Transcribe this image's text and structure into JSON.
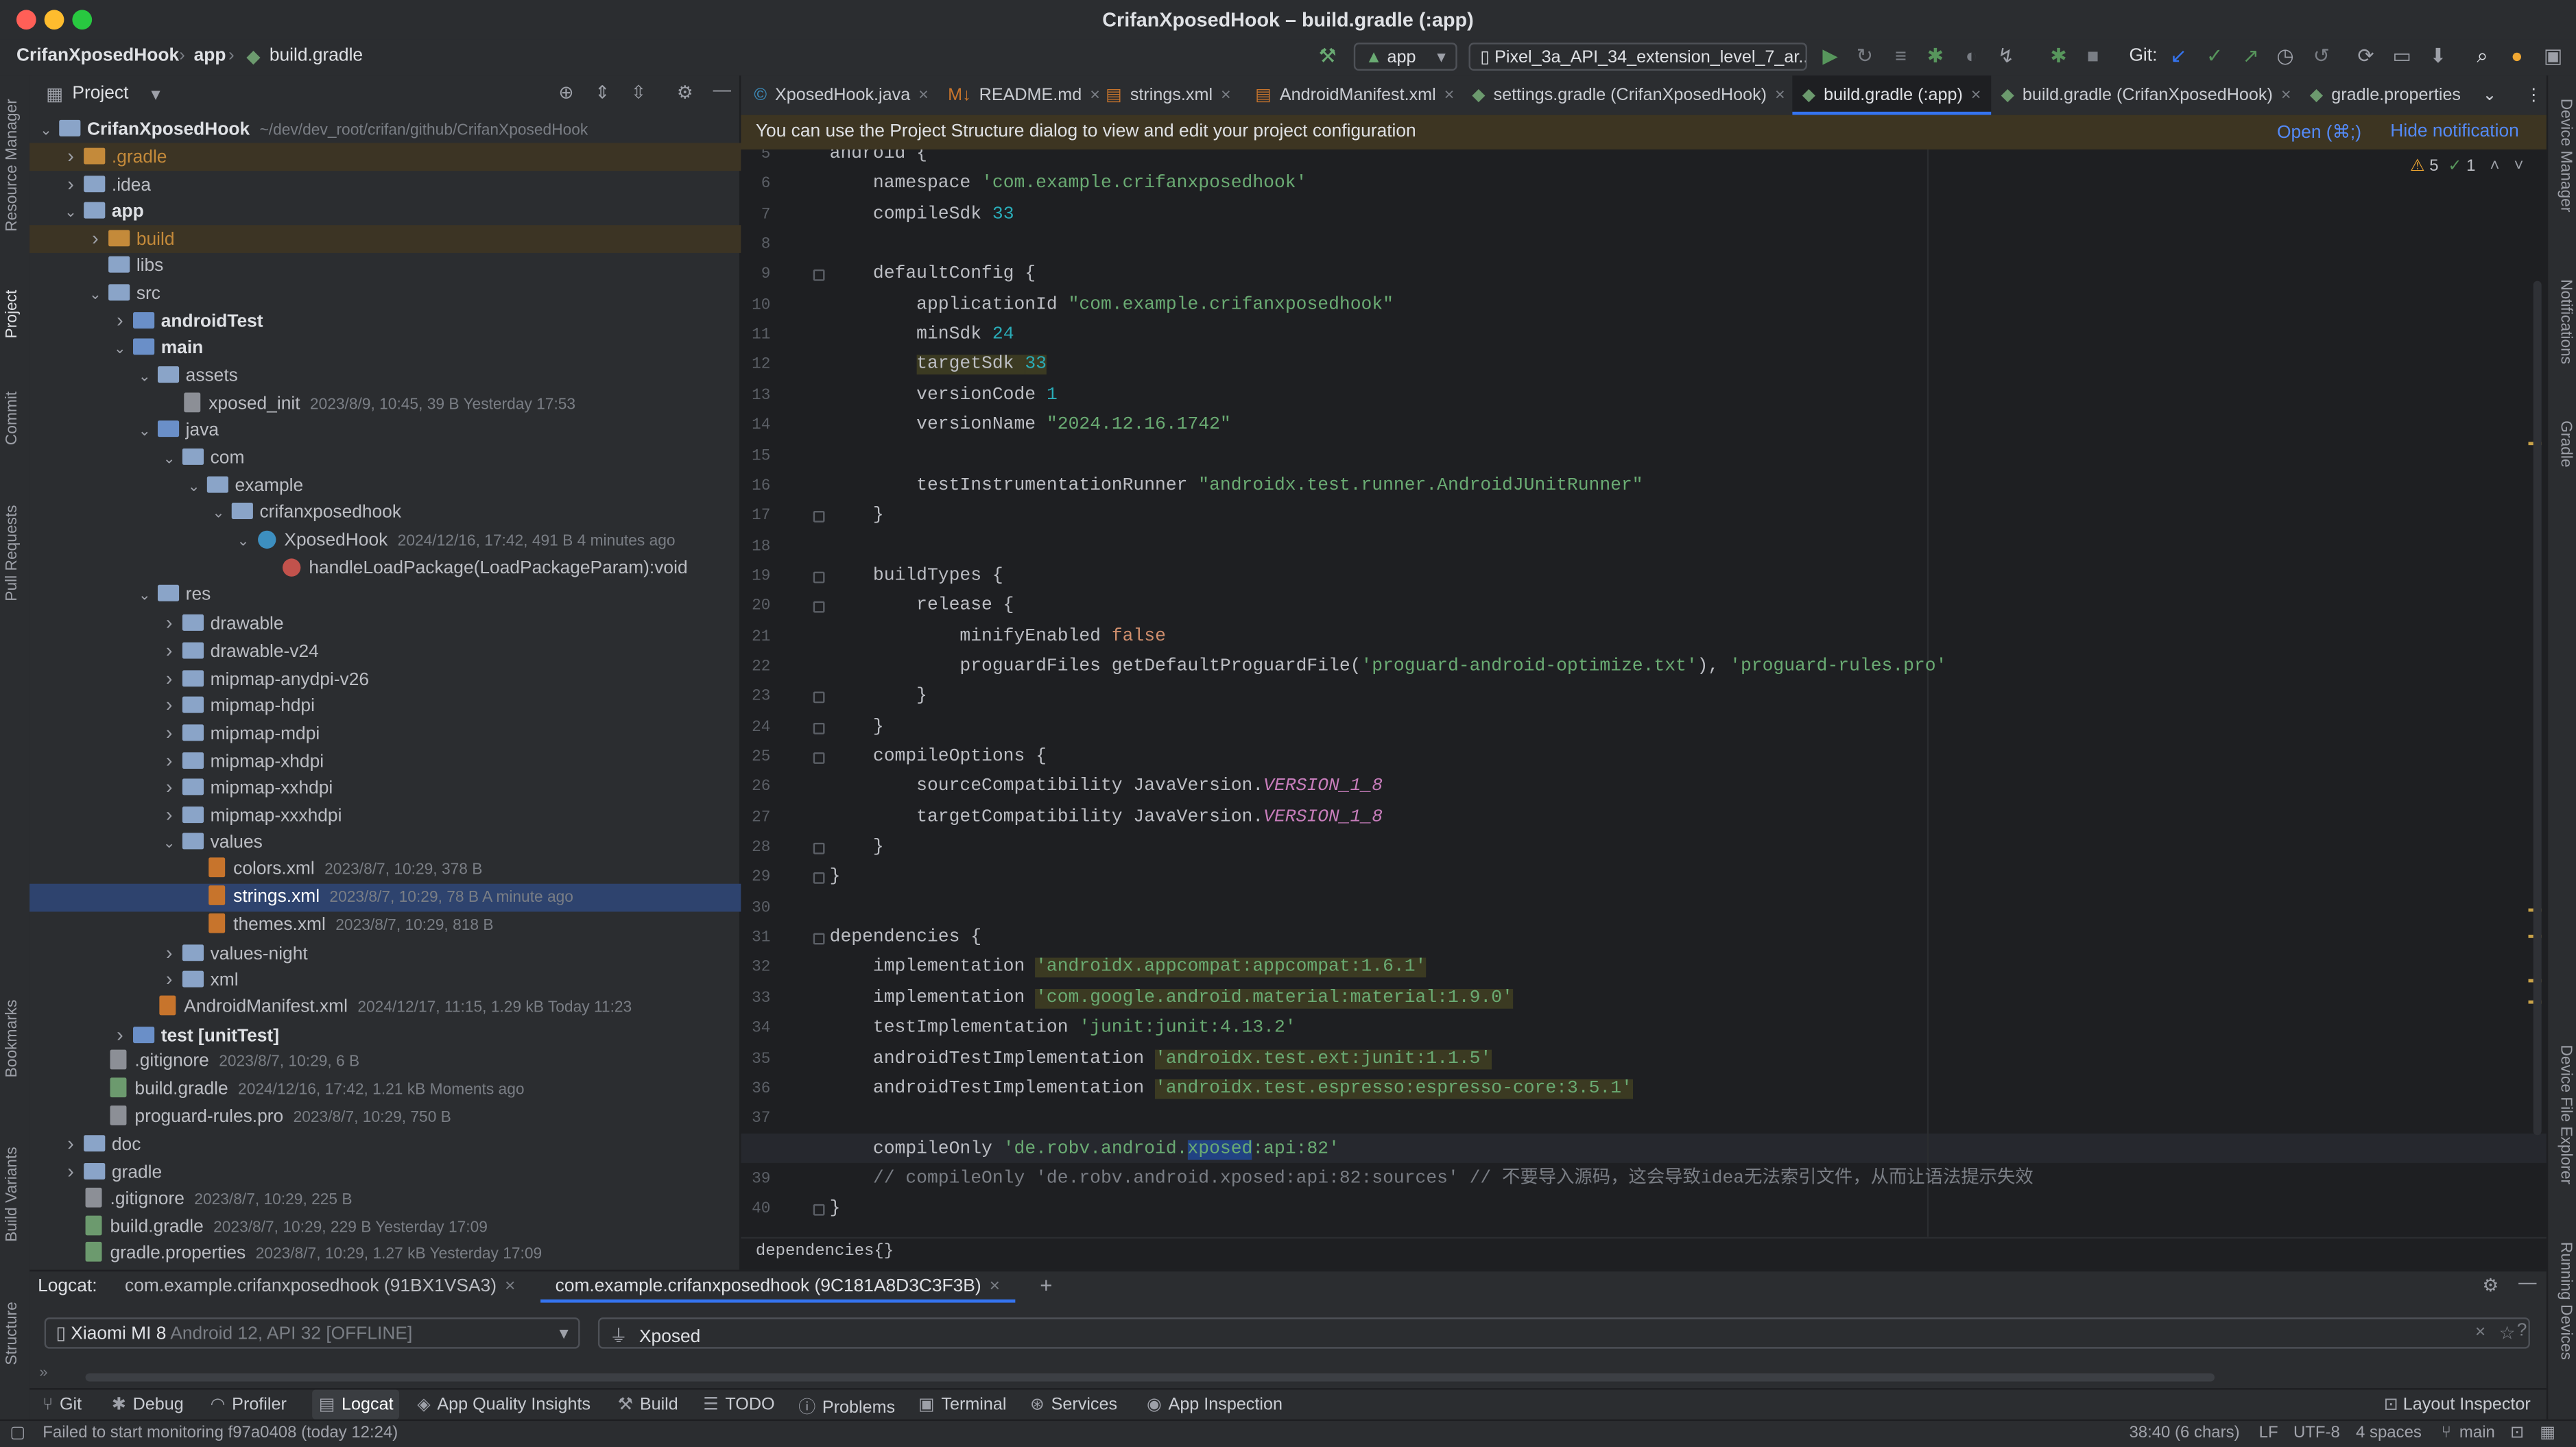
{
  "window": {
    "title": "CrifanXposedHook – build.gradle (:app)"
  },
  "toolbar": {
    "breadcrumb": [
      "CrifanXposedHook",
      "app",
      "build.gradle"
    ],
    "run_config": "app",
    "device": "Pixel_3a_API_34_extension_level_7_ar...",
    "git_label": "Git:"
  },
  "sidebar_left": {
    "items": [
      "Resource Manager",
      "Project",
      "Commit",
      "Pull Requests",
      "Bookmarks",
      "Build Variants",
      "Structure"
    ]
  },
  "sidebar_right": {
    "items": [
      "Device Manager",
      "Notifications",
      "Gradle",
      "Device File Explorer",
      "Running Devices"
    ]
  },
  "project_panel": {
    "title": "Project",
    "tree": [
      {
        "name": "CrifanXposedHook",
        "meta": "~/dev/dev_root/crifan/github/CrifanXposedHook",
        "level": 0,
        "arrow": "down",
        "kind": "folder",
        "bold": true
      },
      {
        "name": ".gradle",
        "meta": "",
        "level": 1,
        "arrow": "right",
        "kind": "folder-orange",
        "style": "orange",
        "hl": true
      },
      {
        "name": ".idea",
        "meta": "",
        "level": 1,
        "arrow": "right",
        "kind": "folder"
      },
      {
        "name": "app",
        "meta": "",
        "level": 1,
        "arrow": "down",
        "kind": "folder",
        "bold": true
      },
      {
        "name": "build",
        "meta": "",
        "level": 2,
        "arrow": "right",
        "kind": "folder-orange",
        "style": "orange",
        "hl": true
      },
      {
        "name": "libs",
        "meta": "",
        "level": 2,
        "arrow": "",
        "kind": "folder"
      },
      {
        "name": "src",
        "meta": "",
        "level": 2,
        "arrow": "down",
        "kind": "folder"
      },
      {
        "name": "androidTest",
        "meta": "",
        "level": 3,
        "arrow": "right",
        "kind": "folder-src",
        "bold": true
      },
      {
        "name": "main",
        "meta": "",
        "level": 3,
        "arrow": "down",
        "kind": "folder-src",
        "bold": true
      },
      {
        "name": "assets",
        "meta": "",
        "level": 4,
        "arrow": "down",
        "kind": "folder"
      },
      {
        "name": "xposed_init",
        "meta": "2023/8/9, 10:45, 39 B Yesterday 17:53",
        "level": 5,
        "arrow": "",
        "kind": "file"
      },
      {
        "name": "java",
        "meta": "",
        "level": 4,
        "arrow": "down",
        "kind": "folder-src"
      },
      {
        "name": "com",
        "meta": "",
        "level": 5,
        "arrow": "down",
        "kind": "folder"
      },
      {
        "name": "example",
        "meta": "",
        "level": 6,
        "arrow": "down",
        "kind": "folder"
      },
      {
        "name": "crifanxposedhook",
        "meta": "",
        "level": 7,
        "arrow": "down",
        "kind": "folder"
      },
      {
        "name": "XposedHook",
        "meta": "2024/12/16, 17:42, 491 B 4 minutes ago",
        "level": 8,
        "arrow": "down",
        "kind": "java"
      },
      {
        "name": "handleLoadPackage(LoadPackageParam):void",
        "meta": "",
        "level": 9,
        "arrow": "",
        "kind": "method"
      },
      {
        "name": "res",
        "meta": "",
        "level": 4,
        "arrow": "down",
        "kind": "folder"
      },
      {
        "name": "drawable",
        "meta": "",
        "level": 5,
        "arrow": "right",
        "kind": "folder"
      },
      {
        "name": "drawable-v24",
        "meta": "",
        "level": 5,
        "arrow": "right",
        "kind": "folder"
      },
      {
        "name": "mipmap-anydpi-v26",
        "meta": "",
        "level": 5,
        "arrow": "right",
        "kind": "folder"
      },
      {
        "name": "mipmap-hdpi",
        "meta": "",
        "level": 5,
        "arrow": "right",
        "kind": "folder"
      },
      {
        "name": "mipmap-mdpi",
        "meta": "",
        "level": 5,
        "arrow": "right",
        "kind": "folder"
      },
      {
        "name": "mipmap-xhdpi",
        "meta": "",
        "level": 5,
        "arrow": "right",
        "kind": "folder"
      },
      {
        "name": "mipmap-xxhdpi",
        "meta": "",
        "level": 5,
        "arrow": "right",
        "kind": "folder"
      },
      {
        "name": "mipmap-xxxhdpi",
        "meta": "",
        "level": 5,
        "arrow": "right",
        "kind": "folder"
      },
      {
        "name": "values",
        "meta": "",
        "level": 5,
        "arrow": "down",
        "kind": "folder"
      },
      {
        "name": "colors.xml",
        "meta": "2023/8/7, 10:29, 378 B",
        "level": 6,
        "arrow": "",
        "kind": "xml"
      },
      {
        "name": "strings.xml",
        "meta": "2023/8/7, 10:29, 78 B A minute ago",
        "level": 6,
        "arrow": "",
        "kind": "xml",
        "selected": true
      },
      {
        "name": "themes.xml",
        "meta": "2023/8/7, 10:29, 818 B",
        "level": 6,
        "arrow": "",
        "kind": "xml"
      },
      {
        "name": "values-night",
        "meta": "",
        "level": 5,
        "arrow": "right",
        "kind": "folder"
      },
      {
        "name": "xml",
        "meta": "",
        "level": 5,
        "arrow": "right",
        "kind": "folder"
      },
      {
        "name": "AndroidManifest.xml",
        "meta": "2024/12/17, 11:15, 1.29 kB Today 11:23",
        "level": 4,
        "arrow": "",
        "kind": "xml"
      },
      {
        "name": "test [unitTest]",
        "meta": "",
        "level": 3,
        "arrow": "right",
        "kind": "folder-src",
        "bold": true
      },
      {
        "name": ".gitignore",
        "meta": "2023/8/7, 10:29, 6 B",
        "level": 2,
        "arrow": "",
        "kind": "file"
      },
      {
        "name": "build.gradle",
        "meta": "2024/12/16, 17:42, 1.21 kB Moments ago",
        "level": 2,
        "arrow": "",
        "kind": "gradle"
      },
      {
        "name": "proguard-rules.pro",
        "meta": "2023/8/7, 10:29, 750 B",
        "level": 2,
        "arrow": "",
        "kind": "file"
      },
      {
        "name": "doc",
        "meta": "",
        "level": 1,
        "arrow": "right",
        "kind": "folder"
      },
      {
        "name": "gradle",
        "meta": "",
        "level": 1,
        "arrow": "right",
        "kind": "folder"
      },
      {
        "name": ".gitignore",
        "meta": "2023/8/7, 10:29, 225 B",
        "level": 1,
        "arrow": "",
        "kind": "file"
      },
      {
        "name": "build.gradle",
        "meta": "2023/8/7, 10:29, 229 B Yesterday 17:09",
        "level": 1,
        "arrow": "",
        "kind": "gradle"
      },
      {
        "name": "gradle.properties",
        "meta": "2023/8/7, 10:29, 1.27 kB Yesterday 17:09",
        "level": 1,
        "arrow": "",
        "kind": "gradle"
      }
    ]
  },
  "editor": {
    "tabs": [
      {
        "label": "XposedHook.java",
        "active": false
      },
      {
        "label": "README.md",
        "active": false
      },
      {
        "label": "strings.xml",
        "active": false
      },
      {
        "label": "AndroidManifest.xml",
        "active": false
      },
      {
        "label": "settings.gradle (CrifanXposedHook)",
        "active": false
      },
      {
        "label": "build.gradle (:app)",
        "active": true
      },
      {
        "label": "build.gradle (CrifanXposedHook)",
        "active": false
      },
      {
        "label": "gradle.properties",
        "active": false
      }
    ],
    "notification": {
      "text": "You can use the Project Structure dialog to view and edit your project configuration",
      "open_label": "Open (⌘;)",
      "hide_label": "Hide notification"
    },
    "inspections": {
      "warnings": "5",
      "ok": "1"
    },
    "lines": [
      {
        "n": "5",
        "tokens": [
          [
            "",
            "android {"
          ]
        ]
      },
      {
        "n": "6",
        "tokens": [
          [
            "",
            "    namespace "
          ],
          [
            "str",
            "'com.example.crifanxposedhook'"
          ]
        ]
      },
      {
        "n": "7",
        "tokens": [
          [
            "",
            "    compileSdk "
          ],
          [
            "num",
            "33"
          ]
        ]
      },
      {
        "n": "8",
        "tokens": [
          [
            "",
            ""
          ]
        ]
      },
      {
        "n": "9",
        "tokens": [
          [
            "",
            "    defaultConfig {"
          ]
        ]
      },
      {
        "n": "10",
        "tokens": [
          [
            "",
            "        applicationId "
          ],
          [
            "str",
            "\"com.example.crifanxposedhook\""
          ]
        ]
      },
      {
        "n": "11",
        "tokens": [
          [
            "",
            "        minSdk "
          ],
          [
            "num",
            "24"
          ]
        ]
      },
      {
        "n": "12",
        "tokens": [
          [
            "",
            "        "
          ],
          [
            "hlbg",
            "targetSdk "
          ],
          [
            "num hlbg",
            "33"
          ]
        ]
      },
      {
        "n": "13",
        "tokens": [
          [
            "",
            "        versionCode "
          ],
          [
            "num",
            "1"
          ]
        ]
      },
      {
        "n": "14",
        "tokens": [
          [
            "",
            "        versionName "
          ],
          [
            "str",
            "\"2024.12.16.1742\""
          ]
        ]
      },
      {
        "n": "15",
        "tokens": [
          [
            "",
            ""
          ]
        ]
      },
      {
        "n": "16",
        "tokens": [
          [
            "",
            "        testInstrumentationRunner "
          ],
          [
            "str",
            "\"androidx.test.runner.AndroidJUnitRunner\""
          ]
        ]
      },
      {
        "n": "17",
        "tokens": [
          [
            "",
            "    }"
          ]
        ]
      },
      {
        "n": "18",
        "tokens": [
          [
            "",
            ""
          ]
        ]
      },
      {
        "n": "19",
        "tokens": [
          [
            "",
            "    buildTypes {"
          ]
        ]
      },
      {
        "n": "20",
        "tokens": [
          [
            "",
            "        release {"
          ]
        ]
      },
      {
        "n": "21",
        "tokens": [
          [
            "",
            "            minifyEnabled "
          ],
          [
            "kw",
            "false"
          ]
        ]
      },
      {
        "n": "22",
        "tokens": [
          [
            "",
            "            proguardFiles getDefaultProguardFile("
          ],
          [
            "str",
            "'proguard-android-optimize.txt'"
          ],
          [
            "",
            "), "
          ],
          [
            "str",
            "'proguard-rules.pro'"
          ]
        ]
      },
      {
        "n": "23",
        "tokens": [
          [
            "",
            "        }"
          ]
        ]
      },
      {
        "n": "24",
        "tokens": [
          [
            "",
            "    }"
          ]
        ]
      },
      {
        "n": "25",
        "tokens": [
          [
            "",
            "    compileOptions {"
          ]
        ]
      },
      {
        "n": "26",
        "tokens": [
          [
            "",
            "        sourceCompatibility JavaVersion."
          ],
          [
            "it",
            "VERSION_1_8"
          ]
        ]
      },
      {
        "n": "27",
        "tokens": [
          [
            "",
            "        targetCompatibility JavaVersion."
          ],
          [
            "it",
            "VERSION_1_8"
          ]
        ]
      },
      {
        "n": "28",
        "tokens": [
          [
            "",
            "    }"
          ]
        ]
      },
      {
        "n": "29",
        "tokens": [
          [
            "",
            "}"
          ]
        ]
      },
      {
        "n": "30",
        "tokens": [
          [
            "",
            ""
          ]
        ]
      },
      {
        "n": "31",
        "tokens": [
          [
            "",
            "dependencies {"
          ]
        ]
      },
      {
        "n": "32",
        "tokens": [
          [
            "",
            "    implementation "
          ],
          [
            "str hlbg",
            "'androidx.appcompat:appcompat:1.6.1'"
          ]
        ]
      },
      {
        "n": "33",
        "tokens": [
          [
            "",
            "    implementation "
          ],
          [
            "str hlbg",
            "'com.google.android.material:material:1.9.0'"
          ]
        ]
      },
      {
        "n": "34",
        "tokens": [
          [
            "",
            "    testImplementation "
          ],
          [
            "str",
            "'junit:junit:4.13.2'"
          ]
        ]
      },
      {
        "n": "35",
        "tokens": [
          [
            "",
            "    androidTestImplementation "
          ],
          [
            "str hlbg",
            "'androidx.test.ext:junit:1.1.5'"
          ]
        ]
      },
      {
        "n": "36",
        "tokens": [
          [
            "",
            "    androidTestImplementation "
          ],
          [
            "str hlbg",
            "'androidx.test.espresso:espresso-core:3.5.1'"
          ]
        ]
      },
      {
        "n": "37",
        "tokens": [
          [
            "",
            ""
          ]
        ]
      },
      {
        "n": "38",
        "tokens": [
          [
            "",
            "    compileOnly "
          ],
          [
            "str",
            "'de.robv.android."
          ],
          [
            "str sel",
            "xposed"
          ],
          [
            "str",
            ":api:82'"
          ]
        ]
      },
      {
        "n": "39",
        "tokens": [
          [
            "cm",
            "    // compileOnly 'de.robv.android.xposed:api:82:sources' // 不要导入源码，这会导致idea无法索引文件，从而让语法提示失效"
          ]
        ]
      },
      {
        "n": "40",
        "tokens": [
          [
            "",
            "}"
          ]
        ]
      }
    ],
    "current_line": "38",
    "breadcrumb": "dependencies{}"
  },
  "logcat": {
    "label": "Logcat:",
    "tabs": [
      {
        "label": "com.example.crifanxposedhook (91BX1VSA3)",
        "active": false
      },
      {
        "label": "com.example.crifanxposedhook (9C181A8D3C3F3B)",
        "active": true
      }
    ],
    "device": {
      "name": "Xiaomi MI 8",
      "detail": "Android 12, API 32 [OFFLINE]"
    },
    "filter": "Xposed"
  },
  "bottom_tools": [
    {
      "label": "Git",
      "icon": "git-icon"
    },
    {
      "label": "Debug",
      "icon": "bug-icon"
    },
    {
      "label": "Profiler",
      "icon": "profiler-icon"
    },
    {
      "label": "Logcat",
      "icon": "logcat-icon",
      "active": true
    },
    {
      "label": "App Quality Insights",
      "icon": "insights-icon"
    },
    {
      "label": "Build",
      "icon": "hammer-icon"
    },
    {
      "label": "TODO",
      "icon": "list-icon"
    },
    {
      "label": "Problems",
      "icon": "info-icon"
    },
    {
      "label": "Terminal",
      "icon": "terminal-icon"
    },
    {
      "label": "Services",
      "icon": "services-icon"
    },
    {
      "label": "App Inspection",
      "icon": "inspection-icon"
    }
  ],
  "layout_inspector_label": "Layout Inspector",
  "status": {
    "message": "Failed to start monitoring f97a0408 (today 12:24)",
    "position": "38:40 (6 chars)",
    "line_sep": "LF",
    "encoding": "UTF-8",
    "indent": "4 spaces",
    "branch": "main"
  },
  "colors": {
    "accent": "#3574f0",
    "selection": "#2e436e",
    "string": "#6aab73",
    "number": "#2aacb8",
    "keyword": "#cf8e6d"
  }
}
